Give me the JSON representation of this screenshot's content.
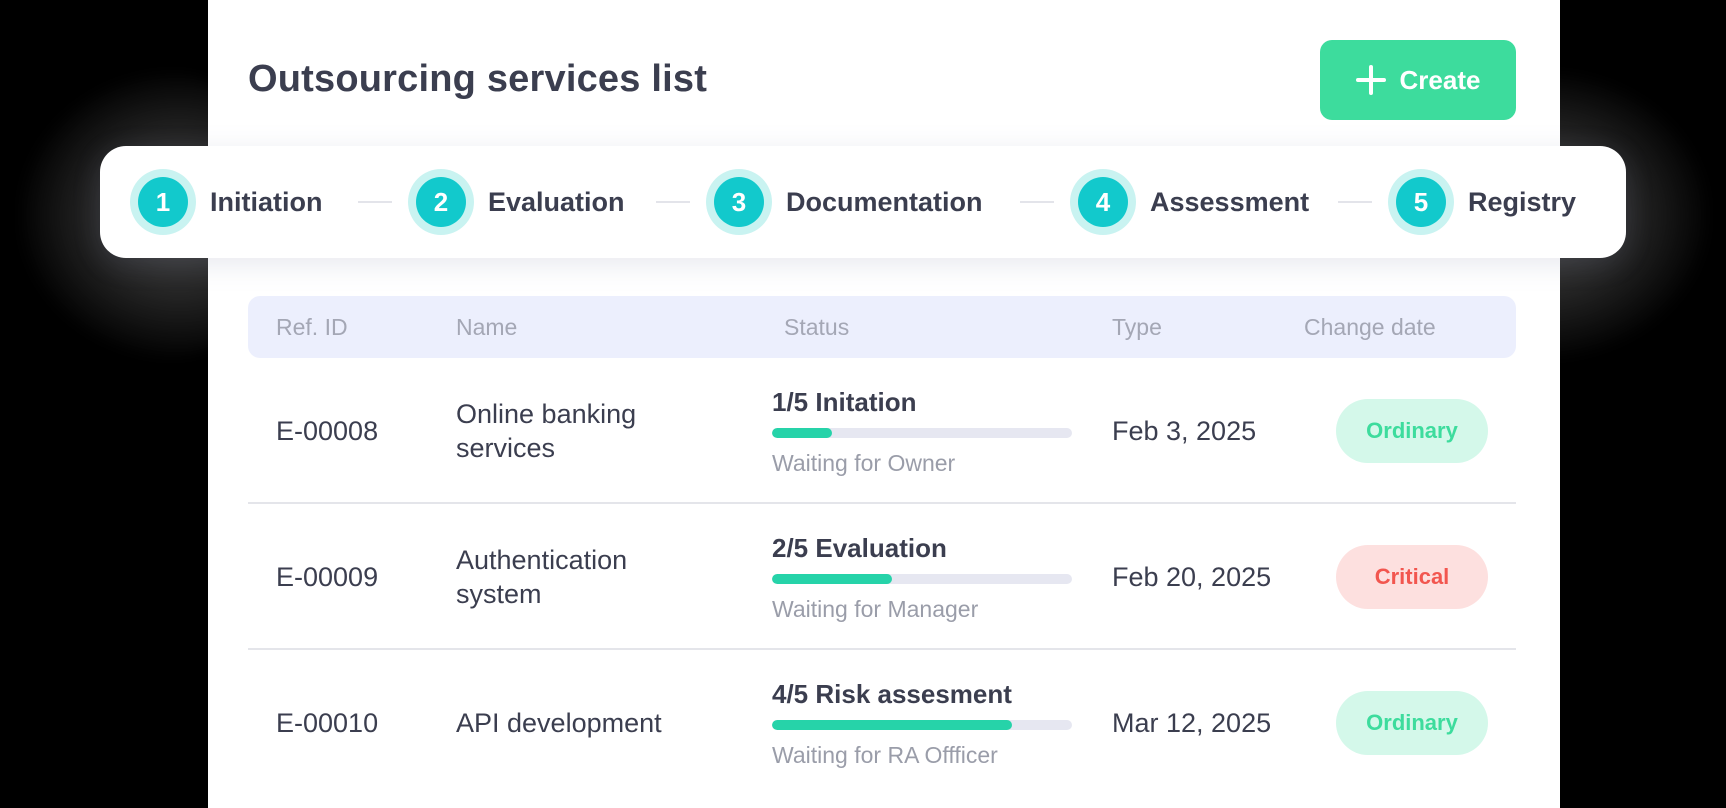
{
  "page": {
    "title": "Outsourcing services list",
    "create_label": "Create"
  },
  "stepper": {
    "steps": [
      {
        "number": "1",
        "label": "Initiation"
      },
      {
        "number": "2",
        "label": "Evaluation"
      },
      {
        "number": "3",
        "label": "Documentation"
      },
      {
        "number": "4",
        "label": "Assessment"
      },
      {
        "number": "5",
        "label": "Registry"
      }
    ]
  },
  "table": {
    "headers": [
      "Ref. ID",
      "Name",
      "Status",
      "Type",
      "Change date"
    ],
    "rows": [
      {
        "ref_id": "E-00008",
        "name": "Online banking services",
        "status_title": "1/5 Initation",
        "status_progress": 0.2,
        "status_sub": "Waiting for Owner",
        "date": "Feb 3, 2025",
        "badge": "Ordinary"
      },
      {
        "ref_id": "E-00009",
        "name": "Authentication system",
        "status_title": "2/5 Evaluation",
        "status_progress": 0.4,
        "status_sub": "Waiting for Manager",
        "date": "Feb 20, 2025",
        "badge": "Critical"
      },
      {
        "ref_id": "E-00010",
        "name": "API development",
        "status_title": "4/5 Risk assesment",
        "status_progress": 0.8,
        "status_sub": "Waiting for RA Offficer",
        "date": "Mar 12, 2025",
        "badge": "Ordinary"
      }
    ]
  },
  "colors": {
    "accent_green": "#3ddc9d",
    "step_teal": "#12c9cc",
    "progress_fill": "#26d3a9",
    "critical_red": "#f2564f",
    "text_dark": "#3b3e4f",
    "header_bg": "#eceffd"
  },
  "icons": {
    "create": "plus-icon"
  }
}
